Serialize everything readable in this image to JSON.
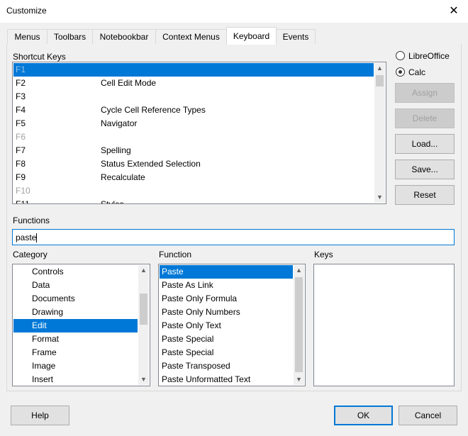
{
  "window": {
    "title": "Customize",
    "close_icon": "close-icon"
  },
  "tabs": [
    "Menus",
    "Toolbars",
    "Notebookbar",
    "Context Menus",
    "Keyboard",
    "Events"
  ],
  "active_tab": "Keyboard",
  "shortcut_keys": {
    "label": "Shortcut Keys",
    "rows": [
      {
        "key": "F1",
        "command": "",
        "disabled": true,
        "selected": true
      },
      {
        "key": "F2",
        "command": "Cell Edit Mode",
        "disabled": false
      },
      {
        "key": "F3",
        "command": "",
        "disabled": false
      },
      {
        "key": "F4",
        "command": "Cycle Cell Reference Types",
        "disabled": false
      },
      {
        "key": "F5",
        "command": "Navigator",
        "disabled": false
      },
      {
        "key": "F6",
        "command": "",
        "disabled": true
      },
      {
        "key": "F7",
        "command": "Spelling",
        "disabled": false
      },
      {
        "key": "F8",
        "command": "Status Extended Selection",
        "disabled": false
      },
      {
        "key": "F9",
        "command": "Recalculate",
        "disabled": false
      },
      {
        "key": "F10",
        "command": "",
        "disabled": true
      },
      {
        "key": "F11",
        "command": "Styles",
        "disabled": false
      }
    ]
  },
  "scope": {
    "options": [
      {
        "label": "LibreOffice",
        "selected": false
      },
      {
        "label": "Calc",
        "selected": true
      }
    ]
  },
  "side_buttons": {
    "assign": "Assign",
    "delete": "Delete",
    "load": "Load...",
    "save": "Save...",
    "reset": "Reset"
  },
  "functions": {
    "label": "Functions",
    "search_value": "paste"
  },
  "category": {
    "label": "Category",
    "items": [
      "Controls",
      "Data",
      "Documents",
      "Drawing",
      "Edit",
      "Format",
      "Frame",
      "Image",
      "Insert"
    ],
    "selected": "Edit"
  },
  "function": {
    "label": "Function",
    "items": [
      "Paste",
      "Paste As Link",
      "Paste Only Formula",
      "Paste Only Numbers",
      "Paste Only Text",
      "Paste Special",
      "Paste Special",
      "Paste Transposed",
      "Paste Unformatted Text"
    ],
    "selected": "Paste"
  },
  "keys": {
    "label": "Keys",
    "items": []
  },
  "footer": {
    "help": "Help",
    "ok": "OK",
    "cancel": "Cancel"
  },
  "colors": {
    "accent": "#0078d7",
    "background": "#f0f0f0",
    "disabled_text": "#a0a0a0"
  }
}
